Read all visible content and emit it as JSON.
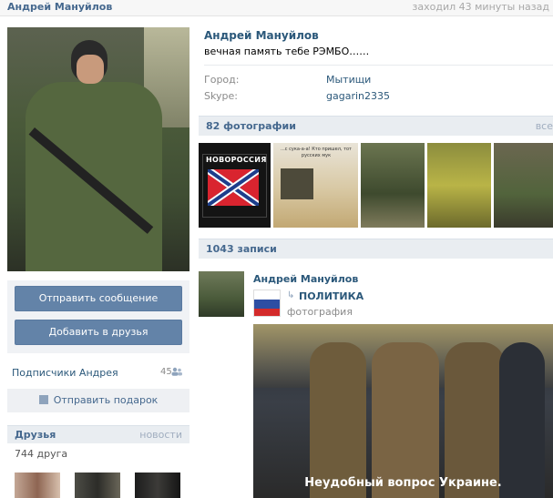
{
  "topbar": {
    "name": "Андрей Мануйлов",
    "last_seen": "заходил 43 минуты назад"
  },
  "profile": {
    "name": "Андрей Мануйлов",
    "status": "вечная память тебе РЭМБО……",
    "info": [
      {
        "label": "Город:",
        "value": "Мытищи"
      },
      {
        "label": "Skype:",
        "value": "gagarin2335"
      }
    ]
  },
  "actions": {
    "send_message": "Отправить сообщение",
    "add_friend": "Добавить в друзья"
  },
  "subscribers": {
    "label": "Подписчики Андрея",
    "count": "45"
  },
  "gift": {
    "label": "Отправить подарок"
  },
  "friends": {
    "title": "Друзья",
    "link": "новости",
    "count": "744 друга"
  },
  "photos": {
    "title": "82 фотографии",
    "all_link": "все",
    "thumb1_text": "НОВОРОССИЯ",
    "thumb2_text": "...с сука-а-а!\nКто пришел, тот русских мук"
  },
  "posts": {
    "title": "1043 записи",
    "author": "Андрей Мануйлов",
    "repost_source": "ПОЛИТИКА",
    "repost_type": "фотография",
    "photo_caption": "Неудобный вопрос Украине."
  },
  "colors": {
    "link": "#2b587a",
    "button": "#6383a8",
    "header_bg": "#e9edf1"
  }
}
